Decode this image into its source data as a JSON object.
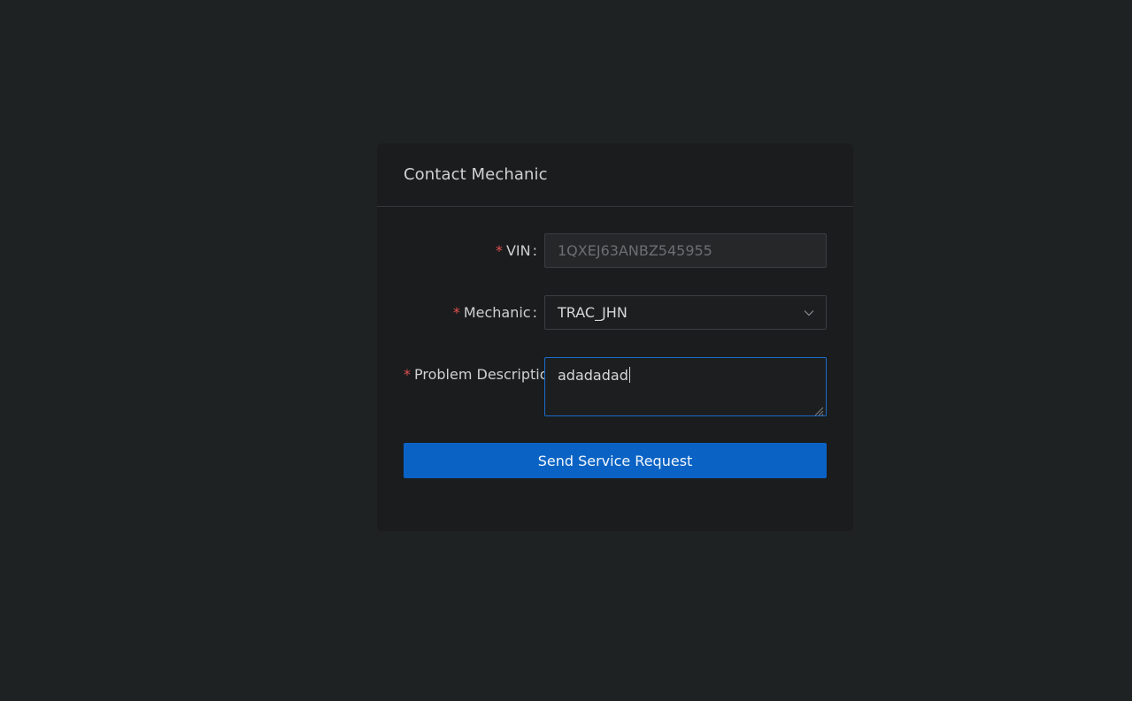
{
  "card": {
    "title": "Contact Mechanic"
  },
  "form": {
    "vin": {
      "required_mark": "*",
      "label": "VIN",
      "colon": ":",
      "value": "1QXEJ63ANBZ545955"
    },
    "mechanic": {
      "required_mark": "*",
      "label": "Mechanic",
      "colon": ":",
      "selected": "TRAC_JHN"
    },
    "problem": {
      "required_mark": "*",
      "label": "Problem Descriptio",
      "value": "adadadad"
    },
    "submit_label": "Send Service Request"
  },
  "colors": {
    "accent": "#0a63c4",
    "required": "#e0504f",
    "background": "#1f2223",
    "card": "#1b1c1e"
  },
  "icons": {
    "select": "chevron-down-icon",
    "textarea": "resize-handle-icon"
  }
}
